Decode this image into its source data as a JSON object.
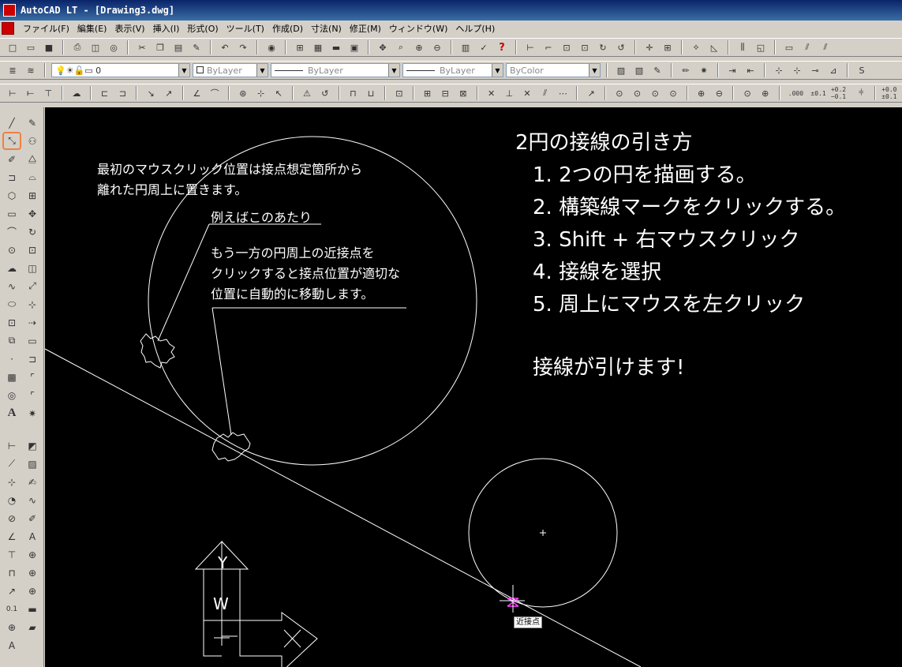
{
  "window": {
    "title": "AutoCAD LT - [Drawing3.dwg]"
  },
  "menu": {
    "items": [
      "ファイル(F)",
      "編集(E)",
      "表示(V)",
      "挿入(I)",
      "形式(O)",
      "ツール(T)",
      "作成(D)",
      "寸法(N)",
      "修正(M)",
      "ウィンドウ(W)",
      "ヘルプ(H)"
    ]
  },
  "toolbar1": {
    "help_label": "?"
  },
  "toolbar2": {
    "layer_value": "0",
    "color_value": "ByLayer",
    "linetype_value": "ByLayer",
    "lineweight_value": "ByLayer",
    "plotstyle_value": "ByColor"
  },
  "toolbar3": {
    "dim_precision": [
      ".000",
      "±0.1",
      "+0.2 −0.1"
    ],
    "tolerance_value": "+0.0 ±0.1"
  },
  "canvas": {
    "note1_line1": "最初のマウスクリック位置は接点想定箇所から",
    "note1_line2": "離れた円周上に置きます。",
    "note2": "例えばこのあたり",
    "note3_line1": "もう一方の円周上の近接点を",
    "note3_line2": "クリックすると接点位置が適切な",
    "note3_line3": "位置に自動的に移動します。",
    "snap_label": "近接点"
  },
  "instructions": {
    "title": "2円の接線の引き方",
    "steps": [
      "1. 2つの円を描画する。",
      "2. 構築線マークをクリックする。",
      "3. Shift + 右マウスクリック",
      "4. 接線を選択",
      "5. 周上にマウスを左クリック"
    ],
    "result": "接線が引けます!"
  },
  "ucs": {
    "y_label": "Y",
    "w_label": "W",
    "x_label": "X"
  },
  "colors": {
    "canvas_bg": "#000000",
    "drawing_lines": "#ffffff",
    "snap_marker": "#ff40ff",
    "active_tool_border": "#f08040"
  }
}
